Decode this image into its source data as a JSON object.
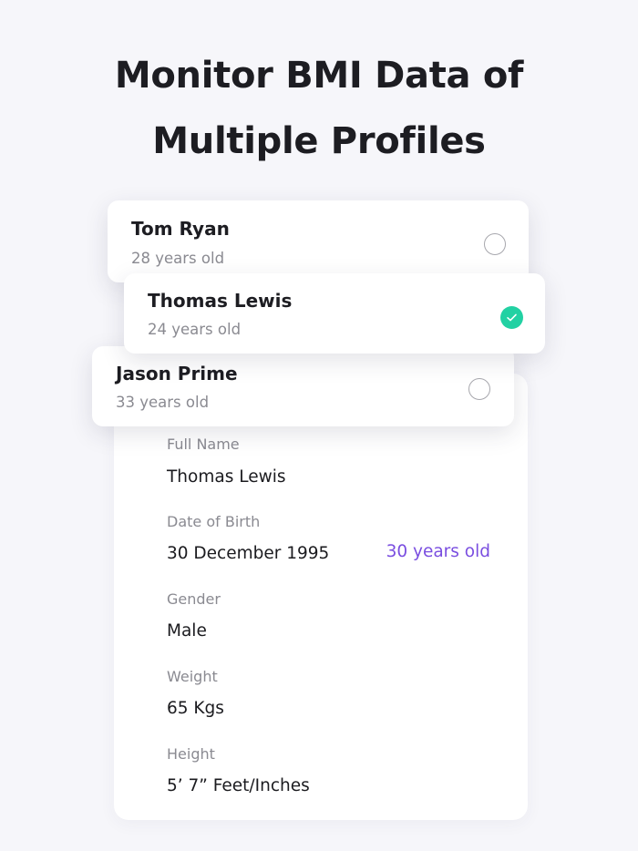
{
  "headline": {
    "line1": "Monitor BMI Data of",
    "line2": "Multiple Profiles"
  },
  "profiles": [
    {
      "name": "Tom Ryan",
      "age": "28 years old",
      "selected": false
    },
    {
      "name": "Thomas Lewis",
      "age": "24 years old",
      "selected": true
    },
    {
      "name": "Jason Prime",
      "age": "33 years old",
      "selected": false
    }
  ],
  "details": {
    "full_name": {
      "label": "Full Name",
      "value": "Thomas Lewis"
    },
    "date_of_birth": {
      "label": "Date of Birth",
      "value": "30 December 1995",
      "age_note": "30 years old"
    },
    "gender": {
      "label": "Gender",
      "value": "Male"
    },
    "weight": {
      "label": "Weight",
      "value": "65 Kgs"
    },
    "height": {
      "label": "Height",
      "value": "5’ 7” Feet/Inches"
    }
  },
  "colors": {
    "background": "#f6f6fa",
    "accent_purple": "#7a4ee0",
    "selected_green": "#22d1a3",
    "muted_text": "#8a8a91"
  },
  "icons": {
    "selected": "checkmark-icon"
  }
}
